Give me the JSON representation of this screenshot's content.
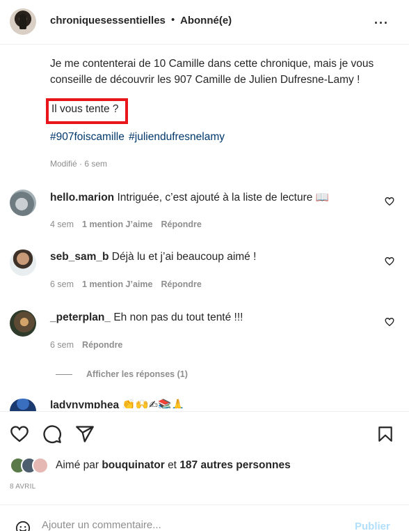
{
  "header": {
    "username": "chroniquesessentielles",
    "separator": "•",
    "follow_status": "Abonné(e)",
    "more": "..."
  },
  "caption": {
    "lines": [
      "Je me contenterai de 10 Camille dans cette chronique, mais je vous",
      "conseille de découvrir les 907 Camille de Julien Dufresne-Lamy !"
    ],
    "question": "Il vous tente ?",
    "hashtags": [
      "#907foiscamille",
      "#juliendufresnelamy"
    ],
    "modified": "Modifié · 6 sem"
  },
  "comments": [
    {
      "username": "hello.marion",
      "text": "Intriguée, c’est ajouté à la liste de lecture 📖",
      "time": "4 sem",
      "likes": "1 mention J’aime",
      "reply": "Répondre"
    },
    {
      "username": "seb_sam_b",
      "text": "Déjà lu et j’ai beaucoup aimé !",
      "time": "6 sem",
      "likes": "1 mention J’aime",
      "reply": "Répondre"
    },
    {
      "username": "_peterplan_",
      "text": "Eh non pas du tout tenté !!!",
      "time": "6 sem",
      "likes": "",
      "reply": "Répondre"
    }
  ],
  "view_replies": "Afficher les réponses (1)",
  "cut_comment": "ladynymphea 👏🙌✍📚🙏",
  "likes": {
    "prefix": "Aimé par",
    "user": "bouquinator",
    "middle": "et",
    "others": "187 autres personnes"
  },
  "date": "8 AVRIL",
  "add_comment": {
    "placeholder": "Ajouter un commentaire...",
    "publish": "Publier"
  },
  "colors": {
    "highlight_box": "#e8161b",
    "hashtag": "#00376b",
    "secondary_text": "#8e8e8e",
    "publish_disabled": "#b2dffc"
  }
}
